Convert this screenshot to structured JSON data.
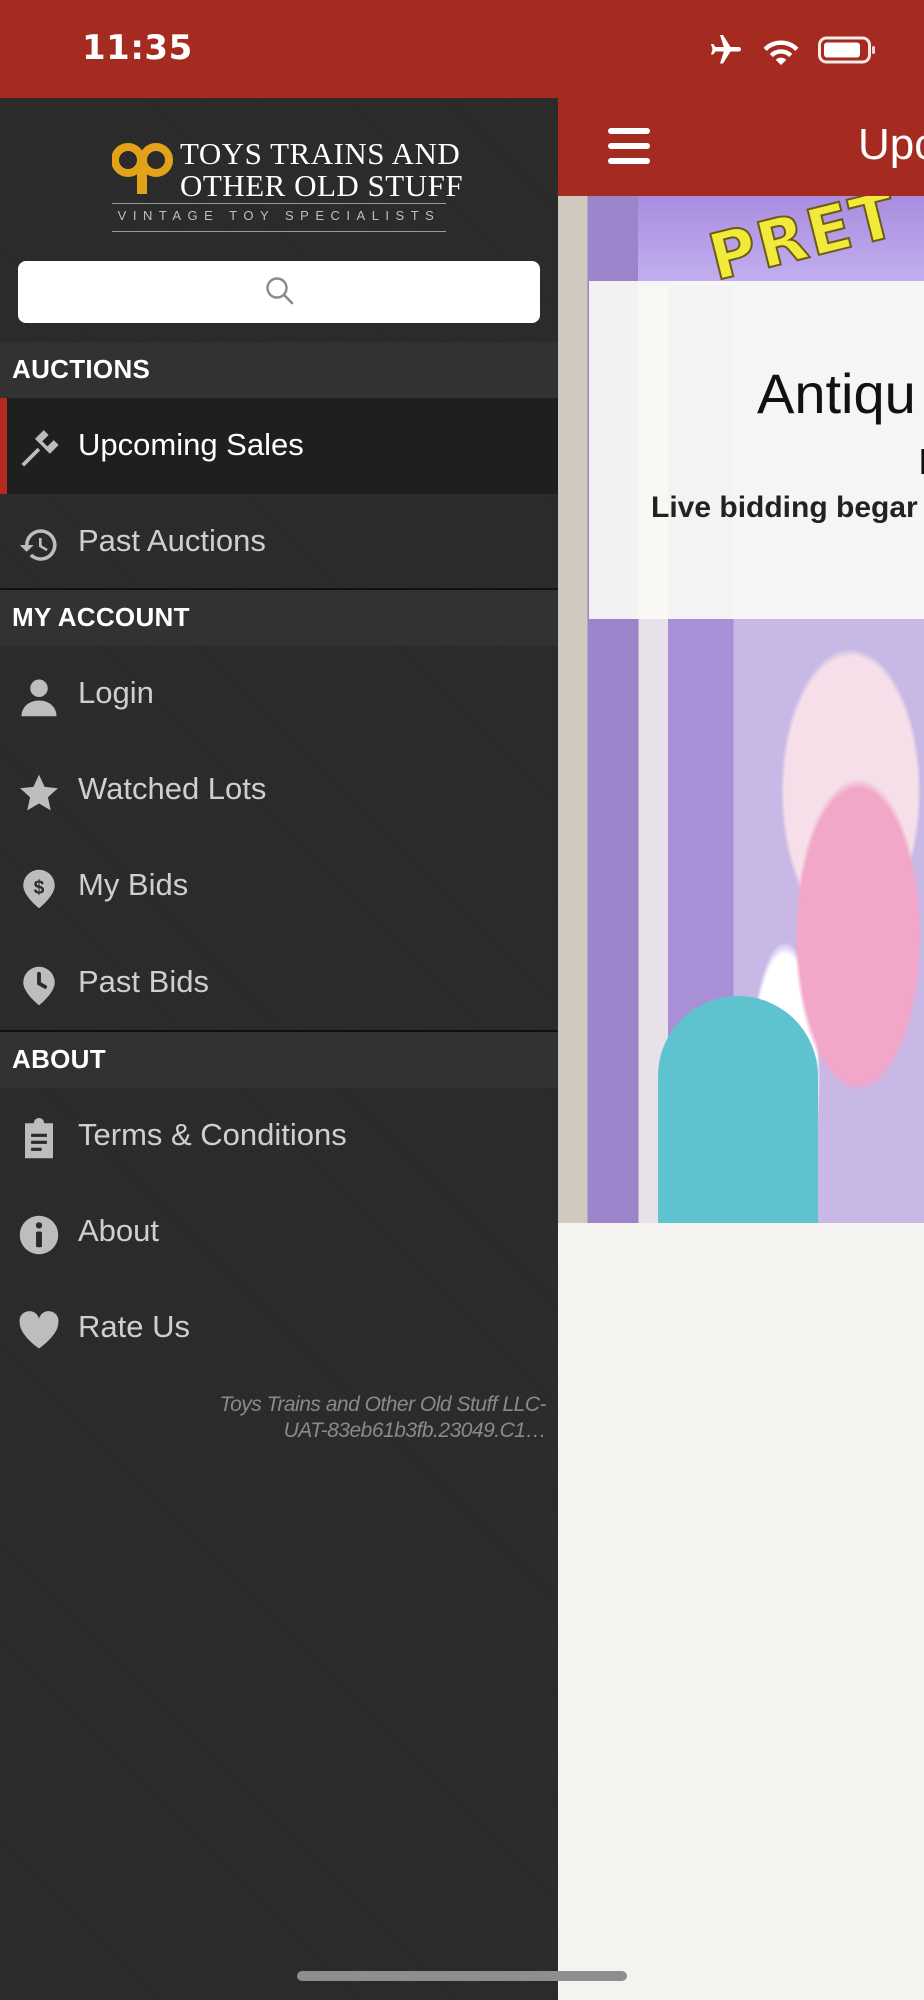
{
  "status_bar": {
    "time": "11:35",
    "icons": [
      "airplane-icon",
      "wifi-icon",
      "battery-icon"
    ]
  },
  "drawer": {
    "logo": {
      "line1": "TOYS TRAINS AND",
      "line2": "OTHER OLD STUFF",
      "tagline": "VINTAGE TOY SPECIALISTS"
    },
    "search": {
      "placeholder": "",
      "value": ""
    },
    "sections": {
      "auctions": {
        "header": "AUCTIONS",
        "items": [
          {
            "label": "Upcoming Sales",
            "icon": "gavel-icon",
            "active": true
          },
          {
            "label": "Past Auctions",
            "icon": "history-icon",
            "active": false
          }
        ]
      },
      "my_account": {
        "header": "MY ACCOUNT",
        "items": [
          {
            "label": "Login",
            "icon": "user-icon"
          },
          {
            "label": "Watched Lots",
            "icon": "star-icon"
          },
          {
            "label": "My Bids",
            "icon": "dollar-pin-icon"
          },
          {
            "label": "Past Bids",
            "icon": "clock-pin-icon"
          }
        ]
      },
      "about": {
        "header": "ABOUT",
        "items": [
          {
            "label": "Terms & Conditions",
            "icon": "clipboard-icon"
          },
          {
            "label": "About",
            "icon": "info-icon"
          },
          {
            "label": "Rate Us",
            "icon": "heart-icon"
          }
        ]
      }
    },
    "version": {
      "line1": "Toys Trains and Other Old Stuff LLC-",
      "line2": "UAT-83eb61b3fb.23049.C1…"
    }
  },
  "main": {
    "header_title": "Upc",
    "hero": {
      "banner_text": "PRET",
      "card_title": "Antiqu",
      "card_line2": "I",
      "card_line3": "Live bidding begar"
    }
  },
  "colors": {
    "brand_red": "#a52a1f",
    "drawer_bg": "#2a2a2a",
    "active_indicator": "#b52a20",
    "logo_gold": "#e3a21a"
  }
}
